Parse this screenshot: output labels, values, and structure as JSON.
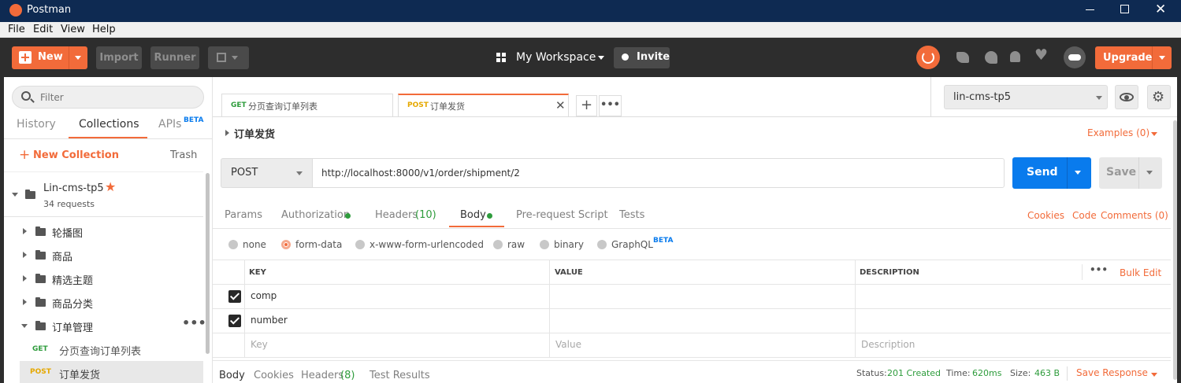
{
  "window": {
    "title": "Postman"
  },
  "menu": [
    "File",
    "Edit",
    "View",
    "Help"
  ],
  "toolbar": {
    "new_label": "New",
    "import_label": "Import",
    "runner_label": "Runner",
    "workspace_label": "My Workspace",
    "invite_label": "Invite",
    "upgrade_label": "Upgrade"
  },
  "sidebar": {
    "filter_placeholder": "Filter",
    "tabs": {
      "history": "History",
      "collections": "Collections",
      "apis": "APIs",
      "apis_badge": "BETA"
    },
    "new_collection": "New Collection",
    "trash": "Trash",
    "collection": {
      "name": "Lin-cms-tp5",
      "count": "34 requests"
    },
    "folders": [
      "轮播图",
      "商品",
      "精选主题",
      "商品分类",
      "订单管理"
    ],
    "requests": [
      {
        "method": "GET",
        "name": "分页查询订单列表"
      },
      {
        "method": "POST",
        "name": "订单发货"
      }
    ]
  },
  "request_tabs": [
    {
      "method": "GET",
      "name": "分页查询订单列表"
    },
    {
      "method": "POST",
      "name": "订单发货"
    }
  ],
  "environment": {
    "selected": "lin-cms-tp5"
  },
  "request": {
    "title": "订单发货",
    "examples": "Examples (0)",
    "method": "POST",
    "url": "http://localhost:8000/v1/order/shipment/2",
    "send": "Send",
    "save": "Save"
  },
  "req_subtabs": {
    "params": "Params",
    "authorization": "Authorization",
    "headers": "Headers",
    "headers_count": "(10)",
    "body": "Body",
    "prerequest": "Pre-request Script",
    "tests": "Tests",
    "cookies": "Cookies",
    "code": "Code",
    "comments": "Comments (0)"
  },
  "body_types": {
    "none": "none",
    "form_data": "form-data",
    "urlencoded": "x-www-form-urlencoded",
    "raw": "raw",
    "binary": "binary",
    "graphql": "GraphQL",
    "graphql_badge": "BETA"
  },
  "params_table": {
    "headers": {
      "key": "KEY",
      "value": "VALUE",
      "description": "DESCRIPTION"
    },
    "bulk_edit": "Bulk Edit",
    "rows": [
      {
        "key": "comp",
        "value": "",
        "description": "",
        "checked": true
      },
      {
        "key": "number",
        "value": "",
        "description": "",
        "checked": true
      }
    ],
    "placeholders": {
      "key": "Key",
      "value": "Value",
      "description": "Description"
    }
  },
  "response": {
    "tabs": {
      "body": "Body",
      "cookies": "Cookies",
      "headers": "Headers",
      "headers_count": "(8)",
      "tests": "Test Results"
    },
    "status_label": "Status:",
    "status_value": "201 Created",
    "time_label": "Time:",
    "time_value": "620ms",
    "size_label": "Size:",
    "size_value": "463 B",
    "save_response": "Save Response"
  },
  "colors": {
    "accent": "#f26b3a",
    "send": "#097bed",
    "status_ok": "#2e9c3c",
    "dark_toolbar": "#2d2d2d",
    "titlebar": "#0e2a52"
  }
}
